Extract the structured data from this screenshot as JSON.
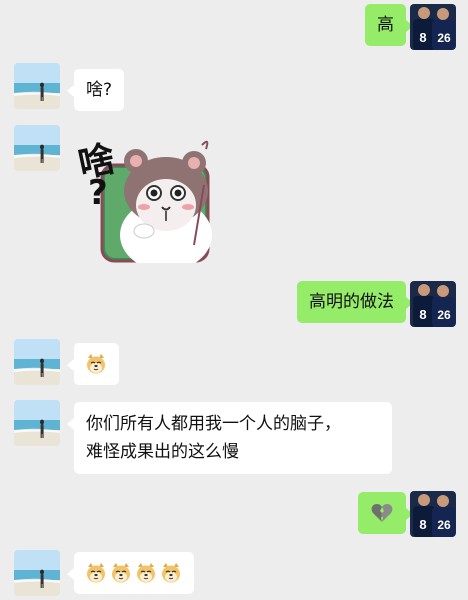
{
  "messages": [
    {
      "side": "right",
      "kind": "text",
      "text": "高"
    },
    {
      "side": "left",
      "kind": "text",
      "text": "啥?"
    },
    {
      "side": "left",
      "kind": "sticker",
      "sticker_name": "hamster-what-sticker",
      "sticker_text": "啥",
      "sticker_mark": "?"
    },
    {
      "side": "right",
      "kind": "text",
      "text": "高明的做法"
    },
    {
      "side": "left",
      "kind": "emoji",
      "emoji": [
        "doge"
      ]
    },
    {
      "side": "left",
      "kind": "text",
      "lines": [
        "你们所有人都用我一个人的脑子，",
        "难怪成果出的这么慢"
      ]
    },
    {
      "side": "right",
      "kind": "emoji",
      "emoji": [
        "broken-heart"
      ]
    },
    {
      "side": "left",
      "kind": "emoji",
      "emoji": [
        "doge",
        "doge",
        "doge",
        "doge"
      ]
    }
  ],
  "colors": {
    "background": "#ededed",
    "sent_bubble": "#95ec69",
    "received_bubble": "#ffffff"
  },
  "avatars": {
    "other": "beach-girl-avatar",
    "self": "jersey-players-avatar",
    "self_numbers": [
      "8",
      "26"
    ]
  }
}
